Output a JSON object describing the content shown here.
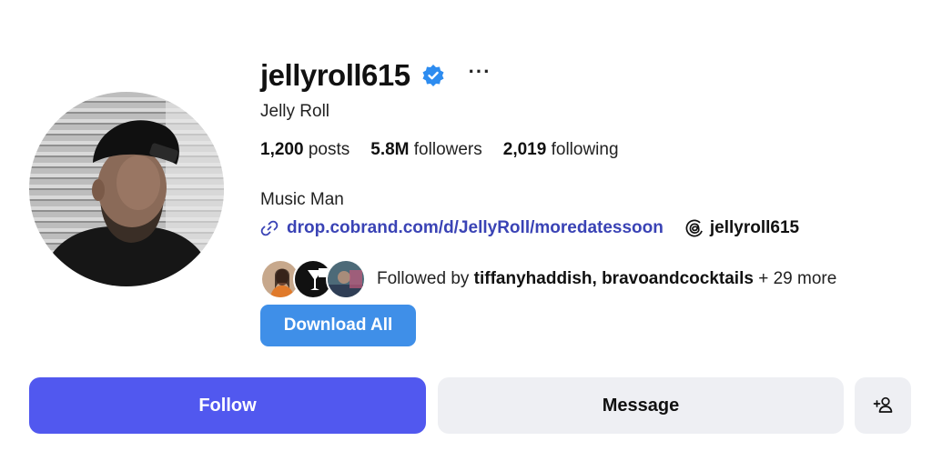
{
  "profile": {
    "username": "jellyroll615",
    "verified": true,
    "full_name": "Jelly Roll",
    "bio": "Music Man",
    "link": "drop.cobrand.com/d/JellyRoll/moredatessoon",
    "threads_handle": "jellyroll615",
    "avatar_icon": "profile-photo"
  },
  "stats": [
    {
      "value": "1,200",
      "label": "posts"
    },
    {
      "value": "5.8M",
      "label": "followers"
    },
    {
      "value": "2,019",
      "label": "following"
    }
  ],
  "followed_by": {
    "prefix": "Followed by",
    "names": "tiffanyhaddish, bravoandcocktails",
    "suffix": "+ 29 more"
  },
  "actions": {
    "download_label": "Download All",
    "follow_label": "Follow",
    "message_label": "Message",
    "more_label": "···"
  },
  "colors": {
    "follow_button": "#5158ef",
    "download_button": "#3f8fe8",
    "link": "#3a43b5",
    "verified_badge": "#2d8cf0",
    "secondary_button": "#eeeff3"
  }
}
